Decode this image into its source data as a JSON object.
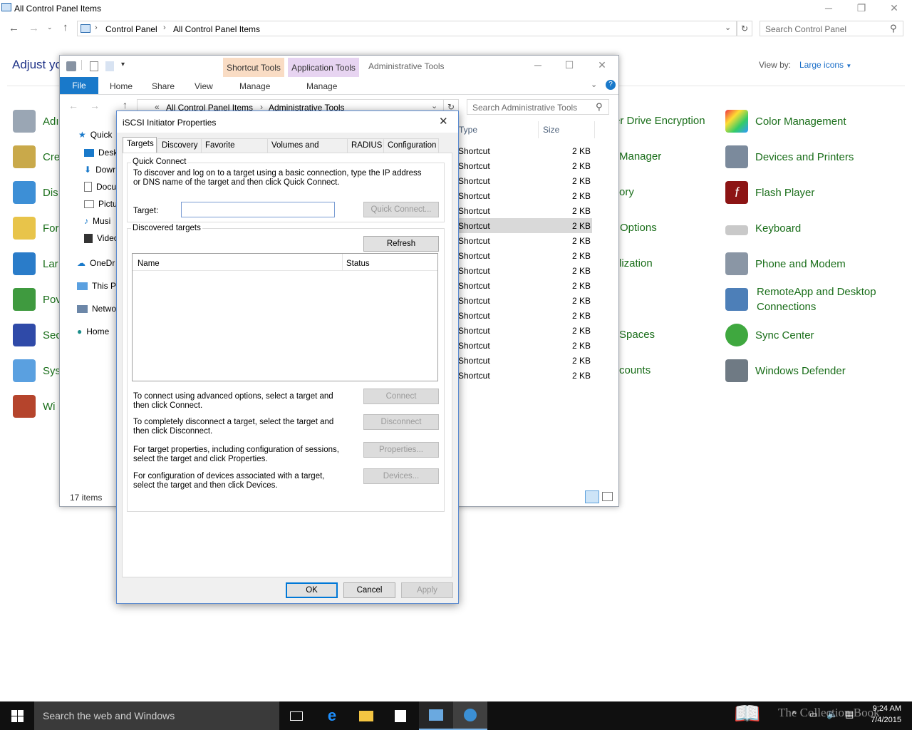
{
  "cp": {
    "title": "All Control Panel Items",
    "breadcrumb": [
      "Control Panel",
      "All Control Panel Items"
    ],
    "search_placeholder": "Search Control Panel",
    "heading": "Adjust yo",
    "view_by_label": "View by:",
    "view_by_value": "Large icons",
    "left_items": [
      "Adı",
      "Cre",
      "Dis",
      "For",
      "Lar",
      "Pov",
      "Sec",
      "Sys",
      "Wi"
    ],
    "mid_items": [
      "er Drive Encryption",
      "Manager",
      "ory",
      "Options",
      "lization",
      "Spaces",
      "counts"
    ],
    "right_items": [
      "Color Management",
      "Devices and Printers",
      "Flash Player",
      "Keyboard",
      "Phone and Modem",
      "RemoteApp and Desktop",
      "Connections",
      "Sync Center",
      "Windows Defender"
    ]
  },
  "at": {
    "title": "Administrative Tools",
    "ctx_shortcut": "Shortcut Tools",
    "ctx_application": "Application Tools",
    "tabs": [
      "File",
      "Home",
      "Share",
      "View",
      "Manage",
      "Manage"
    ],
    "breadcrumb": [
      "All Control Panel Items",
      "Administrative Tools"
    ],
    "search_placeholder": "Search Administrative Tools",
    "nav": [
      "Quick",
      "Deskt",
      "Dowr",
      "Docu",
      "Pictu",
      "Musi",
      "Videc",
      "OneDr",
      "This P",
      "Netwo",
      "Home"
    ],
    "col_type": "Type",
    "col_size": "Size",
    "row_type": "Shortcut",
    "row_size": "2 KB",
    "status": "17 items"
  },
  "dlg": {
    "title": "iSCSI Initiator Properties",
    "tabs": [
      "Targets",
      "Discovery",
      "Favorite Targets",
      "Volumes and Devices",
      "RADIUS",
      "Configuration"
    ],
    "quick_connect_legend": "Quick Connect",
    "quick_connect_desc": "To discover and log on to a target using a basic connection, type the IP address or DNS name of the target and then click Quick Connect.",
    "target_label": "Target:",
    "target_value": "",
    "quick_connect_btn": "Quick Connect...",
    "discovered_legend": "Discovered targets",
    "refresh_btn": "Refresh",
    "col_name": "Name",
    "col_status": "Status",
    "connect_desc": "To connect using advanced options, select a target and then click Connect.",
    "connect_btn": "Connect",
    "disconnect_desc": "To completely disconnect a target, select the target and then click Disconnect.",
    "disconnect_btn": "Disconnect",
    "properties_desc": "For target properties, including configuration of sessions, select the target and click Properties.",
    "properties_btn": "Properties...",
    "devices_desc": "For configuration of devices associated with a target, select the target and then click Devices.",
    "devices_btn": "Devices...",
    "ok_btn": "OK",
    "cancel_btn": "Cancel",
    "apply_btn": "Apply"
  },
  "taskbar": {
    "search_placeholder": "Search the web and Windows",
    "time": "9:24 AM",
    "date": "7/4/2015",
    "watermark": "The Collection Book"
  }
}
